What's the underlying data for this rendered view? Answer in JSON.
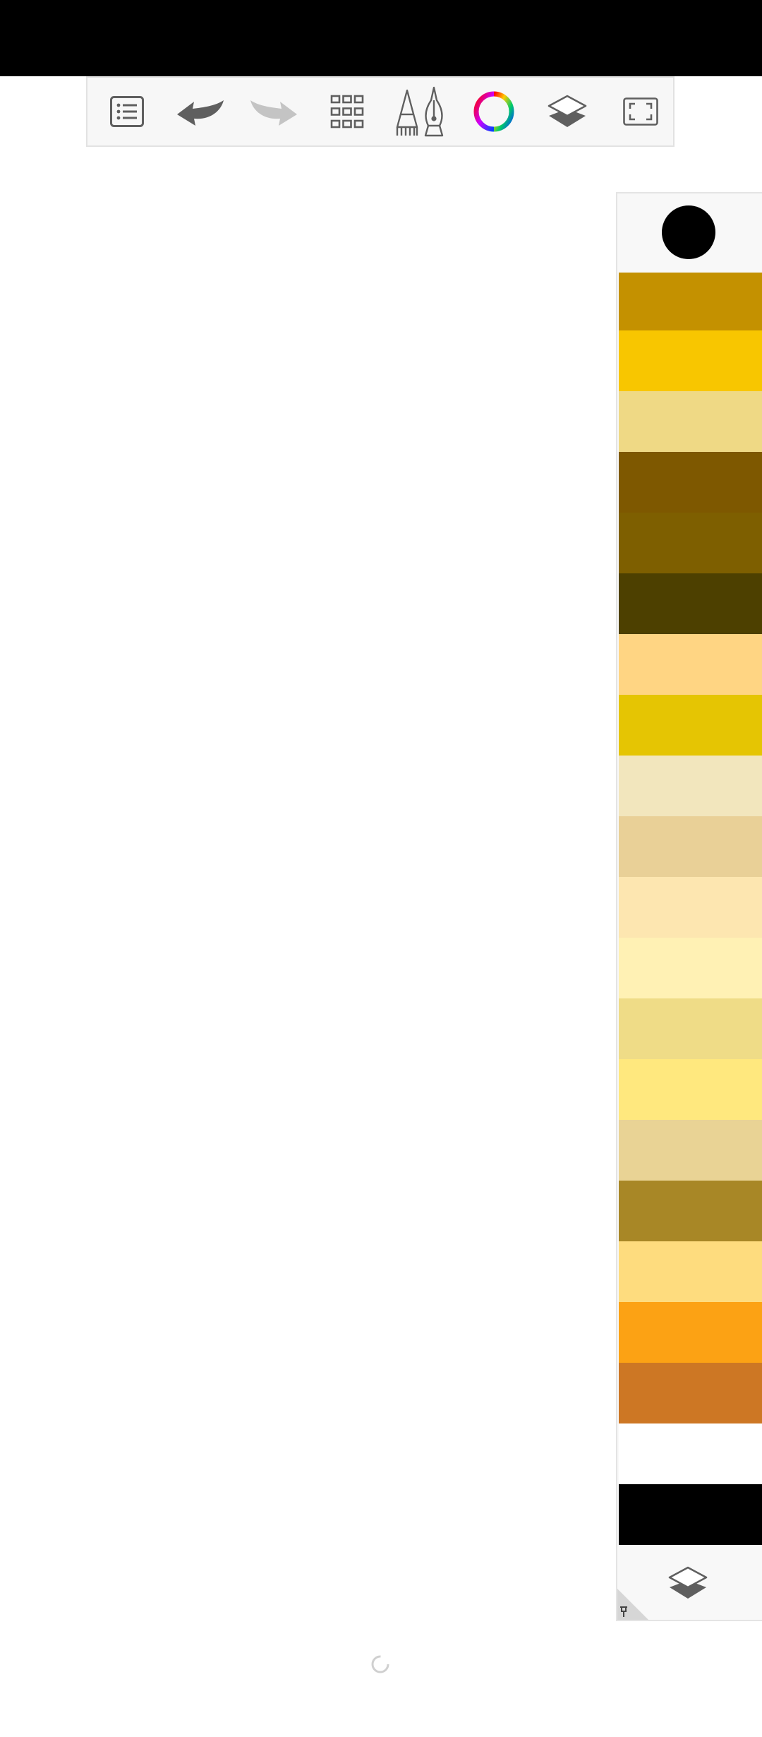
{
  "toolbar": {
    "buttons": [
      {
        "name": "menu-list-icon"
      },
      {
        "name": "undo-icon"
      },
      {
        "name": "redo-icon"
      },
      {
        "name": "grid-icon"
      },
      {
        "name": "brush-tools-icon"
      },
      {
        "name": "color-wheel-icon"
      },
      {
        "name": "layers-icon"
      },
      {
        "name": "fullscreen-icon"
      }
    ]
  },
  "palette": {
    "current_color": "#000000",
    "swatches": [
      "#c49100",
      "#f8c600",
      "#efd985",
      "#7e5800",
      "#7e5f00",
      "#4d4000",
      "#ffd583",
      "#e5c503",
      "#f2e6bd",
      "#e9d097",
      "#fde6b0",
      "#fff1b4",
      "#efdc87",
      "#ffe87e",
      "#e9d395",
      "#a88726",
      "#fedc7e",
      "#fca214",
      "#cd7724",
      "#ffffff",
      "#000000"
    ]
  }
}
